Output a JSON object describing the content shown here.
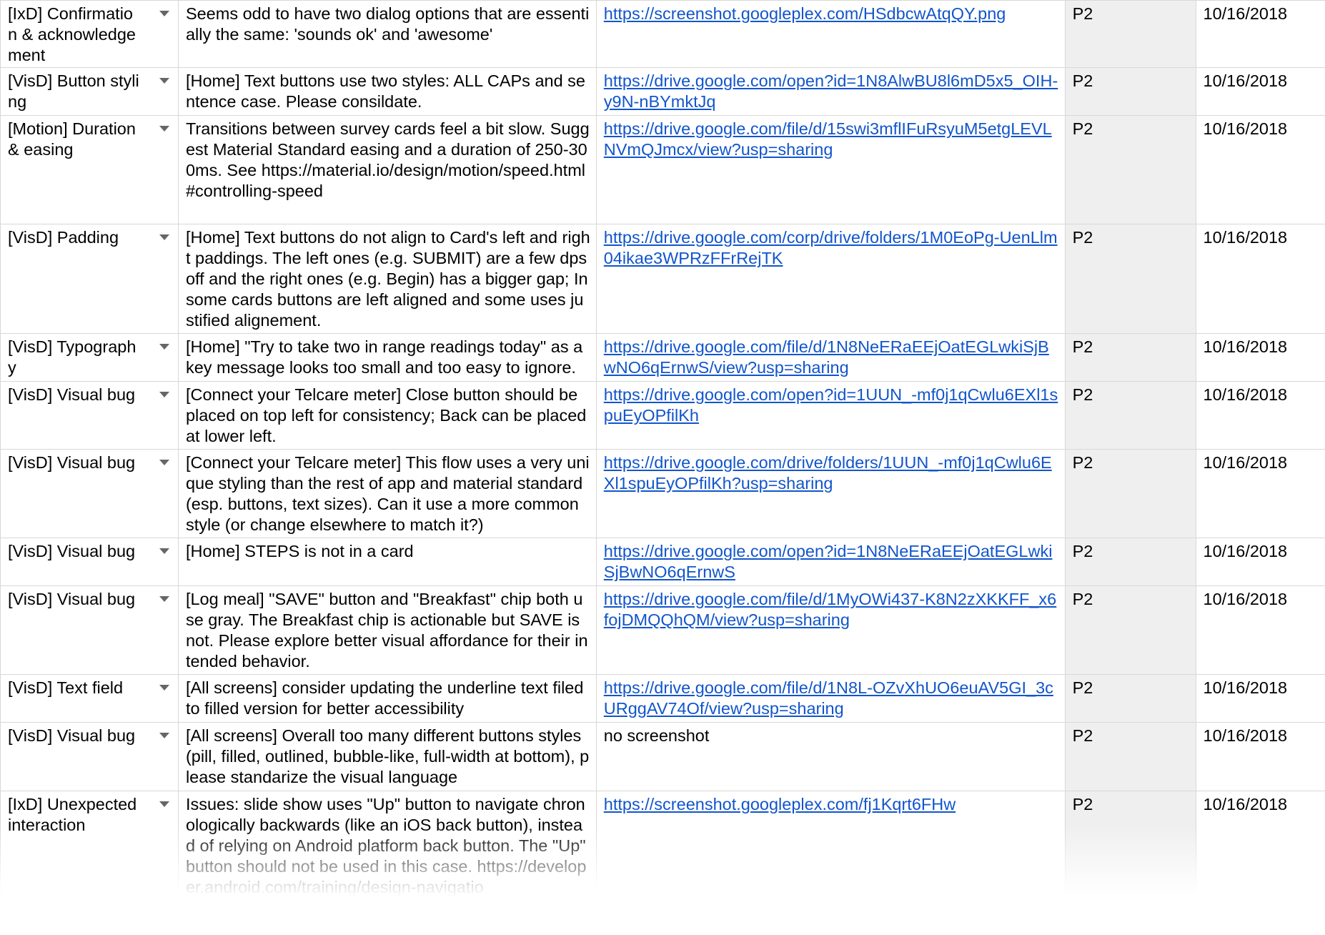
{
  "rows": [
    {
      "category": "[IxD] Confirmation & acknowledgement",
      "description": "Seems odd to have two dialog options that are essentially the same: 'sounds ok' and 'awesome'",
      "screenshot": "https://screenshot.googleplex.com/HSdbcwAtqQY.png",
      "is_link": true,
      "priority": "P2",
      "date": "10/16/2018"
    },
    {
      "category": "[VisD] Button styling",
      "description": "[Home] Text buttons use two styles: ALL CAPs and sentence case. Please consildate.",
      "screenshot": "https://drive.google.com/open?id=1N8AlwBU8l6mD5x5_OIH-y9N-nBYmktJq",
      "is_link": true,
      "priority": "P2",
      "date": "10/16/2018"
    },
    {
      "category": "[Motion] Duration & easing",
      "description": "Transitions between survey cards feel a bit slow. Suggest Material Standard easing and a duration of 250-300ms. See https://material.io/design/motion/speed.html#controlling-speed",
      "screenshot": "https://drive.google.com/file/d/15swi3mflIFuRsyuM5etgLEVLNVmQJmcx/view?usp=sharing",
      "is_link": true,
      "priority": "P2",
      "date": "10/16/2018"
    },
    {
      "category": "[VisD] Padding",
      "description": "[Home] Text buttons do not align to Card's left and right paddings. The left ones (e.g. SUBMIT) are a few dps off and the right ones (e.g. Begin) has a bigger gap; In some cards buttons are left aligned and some uses justified alignement.",
      "screenshot": "https://drive.google.com/corp/drive/folders/1M0EoPg-UenLlm04ikae3WPRzFFrRejTK",
      "is_link": true,
      "priority": "P2",
      "date": "10/16/2018"
    },
    {
      "category": "[VisD] Typography",
      "description": "[Home] \"Try to take two in range readings today\" as a key message looks too small and too easy to ignore.",
      "screenshot": "https://drive.google.com/file/d/1N8NeERaEEjOatEGLwkiSjBwNO6qErnwS/view?usp=sharing",
      "is_link": true,
      "priority": "P2",
      "date": "10/16/2018"
    },
    {
      "category": "[VisD] Visual bug",
      "description": "[Connect your Telcare meter] Close button should be placed on top left for consistency; Back can be placed at lower left.",
      "screenshot": "https://drive.google.com/open?id=1UUN_-mf0j1qCwlu6EXl1spuEyOPfilKh",
      "is_link": true,
      "priority": "P2",
      "date": "10/16/2018"
    },
    {
      "category": "[VisD] Visual bug",
      "description": "[Connect your Telcare meter] This flow uses a very unique styling than the rest of app and material standard (esp. buttons, text sizes). Can it use a more common style (or change elsewhere to match it?)",
      "screenshot": "https://drive.google.com/drive/folders/1UUN_-mf0j1qCwlu6EXl1spuEyOPfilKh?usp=sharing",
      "is_link": true,
      "priority": "P2",
      "date": "10/16/2018"
    },
    {
      "category": "[VisD] Visual bug",
      "description": "[Home] STEPS is not in a card",
      "screenshot": "https://drive.google.com/open?id=1N8NeERaEEjOatEGLwkiSjBwNO6qErnwS",
      "is_link": true,
      "priority": "P2",
      "date": "10/16/2018"
    },
    {
      "category": "[VisD] Visual bug",
      "description": "[Log meal] \"SAVE\" button and \"Breakfast\" chip both use gray. The Breakfast chip is actionable but SAVE is not. Please explore better visual affordance for their intended behavior.",
      "screenshot": "https://drive.google.com/file/d/1MyOWi437-K8N2zXKKFF_x6fojDMQQhQM/view?usp=sharing",
      "is_link": true,
      "priority": "P2",
      "date": "10/16/2018"
    },
    {
      "category": "[VisD] Text field",
      "description": "[All screens] consider updating the underline text filed to filled version for better accessibility",
      "screenshot": "https://drive.google.com/file/d/1N8L-OZvXhUO6euAV5GI_3cURggAV74Of/view?usp=sharing",
      "is_link": true,
      "priority": "P2",
      "date": "10/16/2018"
    },
    {
      "category": "[VisD] Visual bug",
      "description": "[All screens] Overall too many different buttons styles (pill, filled, outlined, bubble-like, full-width at bottom), please standarize the visual language",
      "screenshot": "no screenshot",
      "is_link": false,
      "priority": "P2",
      "date": "10/16/2018"
    },
    {
      "category": "[IxD] Unexpected interaction",
      "description": "Issues: slide show uses \"Up\" button to navigate chronologically backwards (like an iOS back button), instead of relying on Android platform back button. The \"Up\" button should not be used in this case. https://developer.android.com/training/design-navigatio",
      "screenshot": " https://screenshot.googleplex.com/fj1Kqrt6FHw",
      "is_link": true,
      "priority": "P2",
      "date": "10/16/2018"
    }
  ]
}
